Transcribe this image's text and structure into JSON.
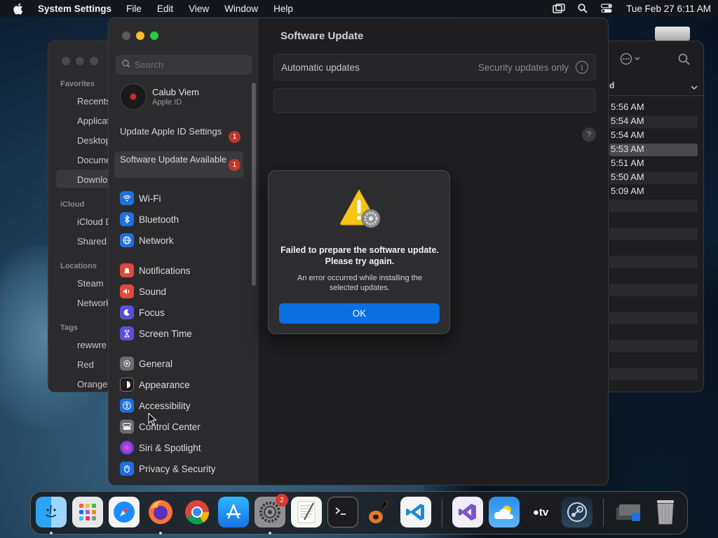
{
  "menubar": {
    "app_name": "System Settings",
    "menus": [
      "File",
      "Edit",
      "View",
      "Window",
      "Help"
    ],
    "clock": "Tue Feb 27  6:11 AM"
  },
  "finder": {
    "sidebar": {
      "favorites_heading": "Favorites",
      "favorites": [
        "Recents",
        "Applications",
        "Desktop",
        "Documents",
        "Downloads"
      ],
      "icloud_heading": "iCloud",
      "icloud": [
        "iCloud Drive",
        "Shared"
      ],
      "locations_heading": "Locations",
      "locations": [
        "Steam",
        "Network"
      ],
      "tags_heading": "Tags",
      "tags": [
        "rewwre",
        "Red",
        "Orange"
      ]
    },
    "column_header": "d",
    "times": [
      "5:56 AM",
      "5:54 AM",
      "5:54 AM",
      "5:53 AM",
      "5:51 AM",
      "5:50 AM",
      "5:09 AM"
    ]
  },
  "settings": {
    "search_placeholder": "Search",
    "account": {
      "name": "Calub Viem",
      "sub": "Apple ID"
    },
    "alerts": [
      {
        "label": "Update Apple ID Settings",
        "badge": "1"
      },
      {
        "label": "Software Update Available",
        "badge": "1"
      }
    ],
    "nav_group1": [
      "Wi-Fi",
      "Bluetooth",
      "Network"
    ],
    "nav_group2": [
      "Notifications",
      "Sound",
      "Focus",
      "Screen Time"
    ],
    "nav_group3": [
      "General",
      "Appearance",
      "Accessibility",
      "Control Center",
      "Siri & Spotlight",
      "Privacy & Security"
    ],
    "main": {
      "title": "Software Update",
      "automatic_label": "Automatic updates",
      "automatic_value": "Security updates only",
      "help": "?"
    }
  },
  "dialog": {
    "title": "Failed to prepare the software update. Please try again.",
    "message": "An error occurred while installing the selected updates.",
    "ok_label": "OK"
  },
  "dock": {
    "settings_badge": "2",
    "apps": [
      "Finder",
      "Launchpad",
      "Safari",
      "Firefox",
      "Chrome",
      "App Store",
      "System Settings",
      "TextEdit",
      "Terminal",
      "GarageBand",
      "Visual Studio Code",
      "Visual Studio",
      "Weather",
      "Apple TV",
      "Steam",
      "Downloads",
      "Trash"
    ]
  }
}
